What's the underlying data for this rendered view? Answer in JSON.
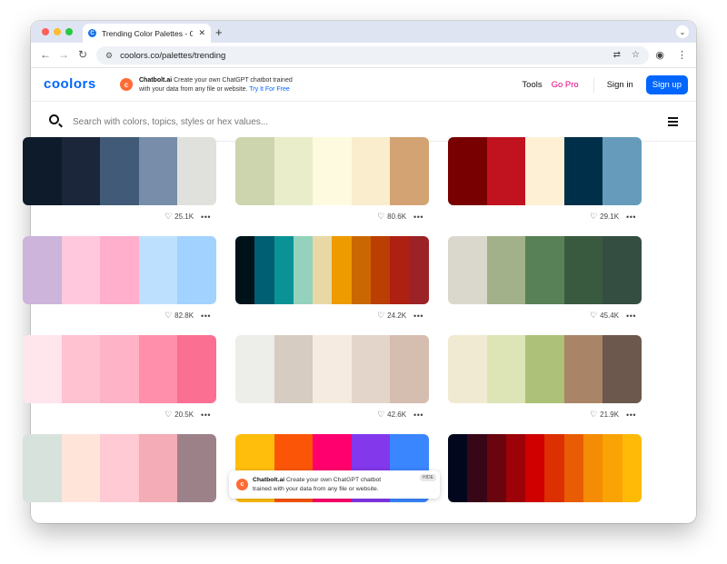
{
  "browser": {
    "tab_title": "Trending Color Palettes - Coo",
    "favicon_letter": "C",
    "new_tab": "+",
    "url": "coolors.co/palettes/trending"
  },
  "header": {
    "logo": "coolors",
    "promo_brand": "Chatbolt.ai",
    "promo_line1": "Create your own ChatGPT chatbot trained",
    "promo_line2": "with your data from any file or website.",
    "promo_cta": "Try It For Free",
    "nav_tools": "Tools",
    "nav_gopro": "Go Pro",
    "nav_signin": "Sign in",
    "nav_signup": "Sign up"
  },
  "search": {
    "placeholder": "Search with colors, topics, styles or hex values..."
  },
  "palettes": [
    {
      "likes": "25.1K",
      "colors": [
        "#0d1b2a",
        "#1b263b",
        "#415a77",
        "#778da9",
        "#e0e1dd"
      ]
    },
    {
      "likes": "80.6K",
      "colors": [
        "#ccd5ae",
        "#e9edc9",
        "#fefae0",
        "#faedcd",
        "#d4a373"
      ]
    },
    {
      "likes": "29.1K",
      "colors": [
        "#780000",
        "#c1121f",
        "#fdf0d5",
        "#003049",
        "#669bbc"
      ]
    },
    {
      "likes": "82.8K",
      "colors": [
        "#cdb4db",
        "#ffc8dd",
        "#ffafcc",
        "#bde0fe",
        "#a2d2ff"
      ]
    },
    {
      "likes": "24.2K",
      "colors": [
        "#001219",
        "#005f73",
        "#0a9396",
        "#94d2bd",
        "#e9d8a6",
        "#ee9b00",
        "#ca6702",
        "#bb3e03",
        "#ae2012",
        "#9b2226"
      ]
    },
    {
      "likes": "45.4K",
      "colors": [
        "#dad7cd",
        "#a3b18a",
        "#588157",
        "#3a5a40",
        "#344e41"
      ]
    },
    {
      "likes": "20.5K",
      "colors": [
        "#ffe5ec",
        "#ffc2d1",
        "#ffb3c6",
        "#ff8fab",
        "#fb6f92"
      ]
    },
    {
      "likes": "42.6K",
      "colors": [
        "#edede9",
        "#d6ccc2",
        "#f5ebe0",
        "#e3d5ca",
        "#d5bdaf"
      ]
    },
    {
      "likes": "21.9K",
      "colors": [
        "#f0ead2",
        "#dde5b6",
        "#adc178",
        "#a98467",
        "#6c584c"
      ]
    },
    {
      "likes": "",
      "colors": [
        "#d8e2dc",
        "#ffe5d9",
        "#ffcad4",
        "#f4acb7",
        "#9d8189"
      ]
    },
    {
      "likes": "",
      "colors": [
        "#ffbe0b",
        "#fb5607",
        "#ff006e",
        "#8338ec",
        "#3a86ff"
      ]
    },
    {
      "likes": "",
      "colors": [
        "#03071e",
        "#370617",
        "#6a040f",
        "#9d0208",
        "#d00000",
        "#dc2f02",
        "#e85d04",
        "#f48c06",
        "#faa307",
        "#ffba08"
      ]
    }
  ],
  "bottom_ad": {
    "brand": "Chatbolt.ai",
    "line1": "Create your own ChatGPT chatbot",
    "line2": "trained with your data from any file or website.",
    "hide": "HIDE"
  }
}
